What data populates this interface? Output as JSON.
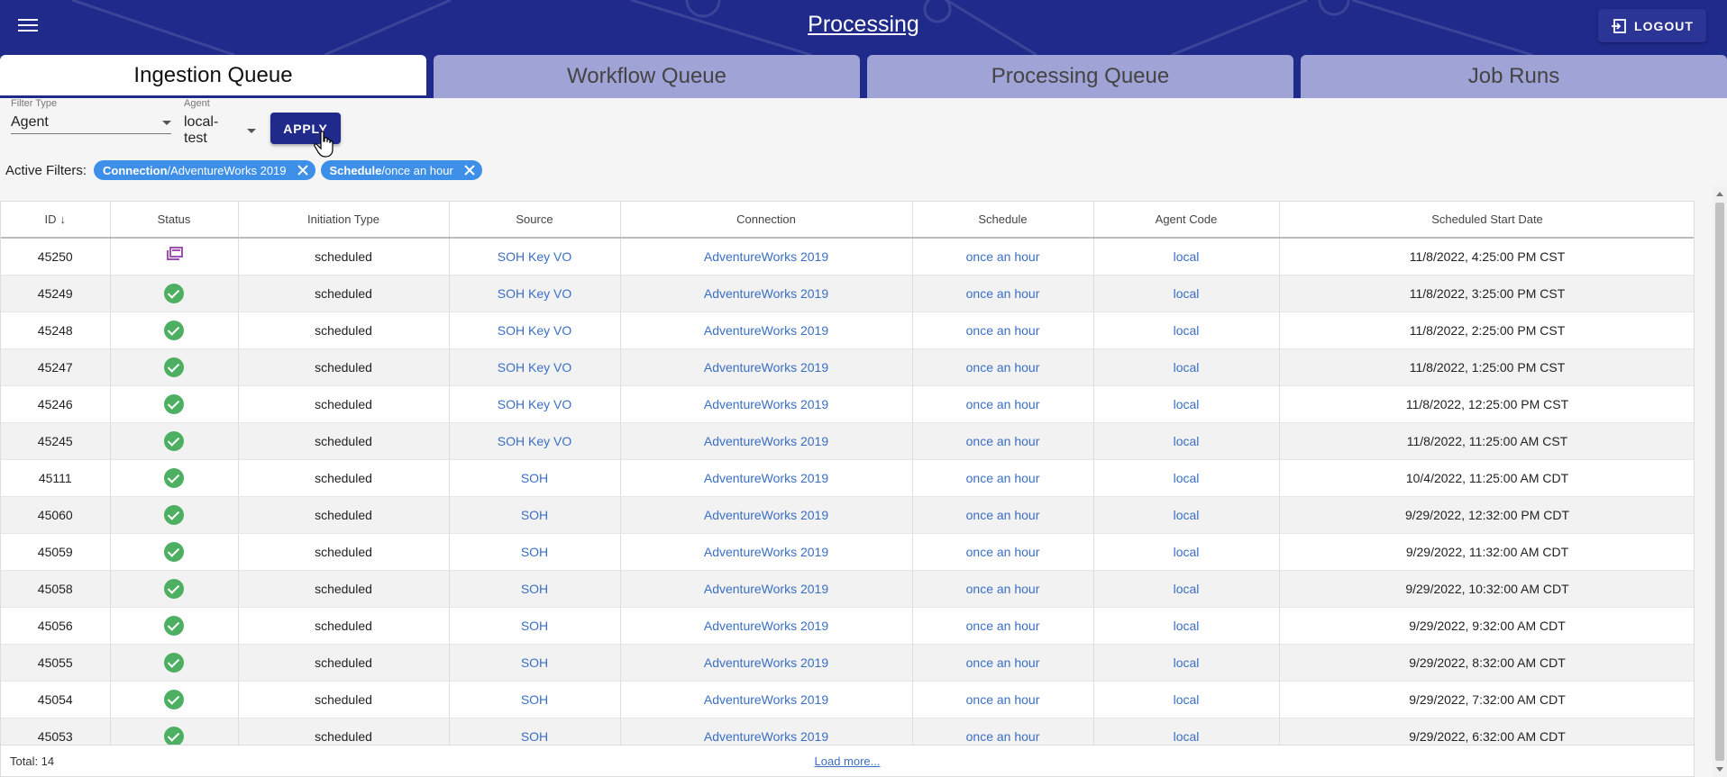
{
  "header": {
    "title": "Processing",
    "logout_label": "LOGOUT"
  },
  "tabs": [
    {
      "label": "Ingestion Queue",
      "active": true
    },
    {
      "label": "Workflow Queue",
      "active": false
    },
    {
      "label": "Processing Queue",
      "active": false
    },
    {
      "label": "Job Runs",
      "active": false
    }
  ],
  "filters": {
    "filter_type_label": "Filter Type",
    "filter_type_value": "Agent",
    "agent_label": "Agent",
    "agent_value": "local-test",
    "apply_label": "APPLY",
    "active_label": "Active Filters:",
    "chips": [
      {
        "key": "Connection",
        "value": "/AdventureWorks 2019"
      },
      {
        "key": "Schedule",
        "value": "/once an hour"
      }
    ]
  },
  "table": {
    "columns": [
      "ID",
      "Status",
      "Initiation Type",
      "Source",
      "Connection",
      "Schedule",
      "Agent Code",
      "Scheduled Start Date"
    ],
    "rows": [
      {
        "id": "45250",
        "status": "running",
        "initiation": "scheduled",
        "source": "SOH Key VO",
        "connection": "AdventureWorks 2019",
        "schedule": "once an hour",
        "agent": "local",
        "start": "11/8/2022, 4:25:00 PM CST"
      },
      {
        "id": "45249",
        "status": "success",
        "initiation": "scheduled",
        "source": "SOH Key VO",
        "connection": "AdventureWorks 2019",
        "schedule": "once an hour",
        "agent": "local",
        "start": "11/8/2022, 3:25:00 PM CST"
      },
      {
        "id": "45248",
        "status": "success",
        "initiation": "scheduled",
        "source": "SOH Key VO",
        "connection": "AdventureWorks 2019",
        "schedule": "once an hour",
        "agent": "local",
        "start": "11/8/2022, 2:25:00 PM CST"
      },
      {
        "id": "45247",
        "status": "success",
        "initiation": "scheduled",
        "source": "SOH Key VO",
        "connection": "AdventureWorks 2019",
        "schedule": "once an hour",
        "agent": "local",
        "start": "11/8/2022, 1:25:00 PM CST"
      },
      {
        "id": "45246",
        "status": "success",
        "initiation": "scheduled",
        "source": "SOH Key VO",
        "connection": "AdventureWorks 2019",
        "schedule": "once an hour",
        "agent": "local",
        "start": "11/8/2022, 12:25:00 PM CST"
      },
      {
        "id": "45245",
        "status": "success",
        "initiation": "scheduled",
        "source": "SOH Key VO",
        "connection": "AdventureWorks 2019",
        "schedule": "once an hour",
        "agent": "local",
        "start": "11/8/2022, 11:25:00 AM CST"
      },
      {
        "id": "45111",
        "status": "success",
        "initiation": "scheduled",
        "source": "SOH",
        "connection": "AdventureWorks 2019",
        "schedule": "once an hour",
        "agent": "local",
        "start": "10/4/2022, 11:25:00 AM CDT"
      },
      {
        "id": "45060",
        "status": "success",
        "initiation": "scheduled",
        "source": "SOH",
        "connection": "AdventureWorks 2019",
        "schedule": "once an hour",
        "agent": "local",
        "start": "9/29/2022, 12:32:00 PM CDT"
      },
      {
        "id": "45059",
        "status": "success",
        "initiation": "scheduled",
        "source": "SOH",
        "connection": "AdventureWorks 2019",
        "schedule": "once an hour",
        "agent": "local",
        "start": "9/29/2022, 11:32:00 AM CDT"
      },
      {
        "id": "45058",
        "status": "success",
        "initiation": "scheduled",
        "source": "SOH",
        "connection": "AdventureWorks 2019",
        "schedule": "once an hour",
        "agent": "local",
        "start": "9/29/2022, 10:32:00 AM CDT"
      },
      {
        "id": "45056",
        "status": "success",
        "initiation": "scheduled",
        "source": "SOH",
        "connection": "AdventureWorks 2019",
        "schedule": "once an hour",
        "agent": "local",
        "start": "9/29/2022, 9:32:00 AM CDT"
      },
      {
        "id": "45055",
        "status": "success",
        "initiation": "scheduled",
        "source": "SOH",
        "connection": "AdventureWorks 2019",
        "schedule": "once an hour",
        "agent": "local",
        "start": "9/29/2022, 8:32:00 AM CDT"
      },
      {
        "id": "45054",
        "status": "success",
        "initiation": "scheduled",
        "source": "SOH",
        "connection": "AdventureWorks 2019",
        "schedule": "once an hour",
        "agent": "local",
        "start": "9/29/2022, 7:32:00 AM CDT"
      },
      {
        "id": "45053",
        "status": "success",
        "initiation": "scheduled",
        "source": "SOH",
        "connection": "AdventureWorks 2019",
        "schedule": "once an hour",
        "agent": "local",
        "start": "9/29/2022, 6:32:00 AM CDT"
      }
    ],
    "total_label": "Total: 14",
    "load_more_label": "Load more..."
  },
  "colors": {
    "primary": "#1f2a8a",
    "chip": "#3d8fe8",
    "link": "#3a6fc4",
    "success": "#4caf62",
    "running": "#a34fb5"
  }
}
